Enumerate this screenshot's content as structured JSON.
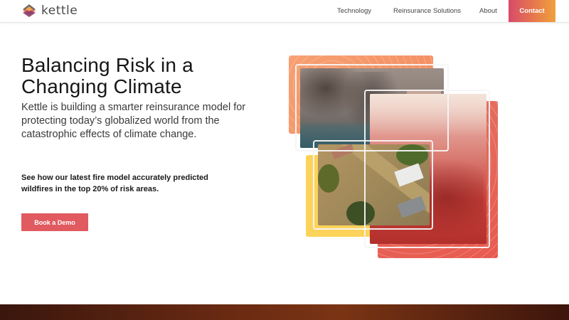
{
  "brand": {
    "name": "kettle"
  },
  "nav": {
    "items": [
      {
        "label": "Technology"
      },
      {
        "label": "Reinsurance Solutions"
      },
      {
        "label": "About"
      }
    ],
    "contact_label": "Contact"
  },
  "hero": {
    "title": "Balancing Risk in a Changing Climate",
    "subtitle": "Kettle is building a smarter reinsurance model for protecting today’s globalized world from the catastrophic effects of climate change.",
    "note": "See how our latest fire model accurately predicted wildfires in the top 20% of risk areas.",
    "cta_label": "Book a Demo"
  },
  "colors": {
    "accent": "#e05a60",
    "contact_gradient_start": "#d84a6a",
    "contact_gradient_end": "#f0a23e",
    "collage_orange": "#f28a5e",
    "collage_red": "#e85a50",
    "collage_yellow": "#fcd35a"
  },
  "icons": {
    "logo": "kettle-logo-icon"
  }
}
